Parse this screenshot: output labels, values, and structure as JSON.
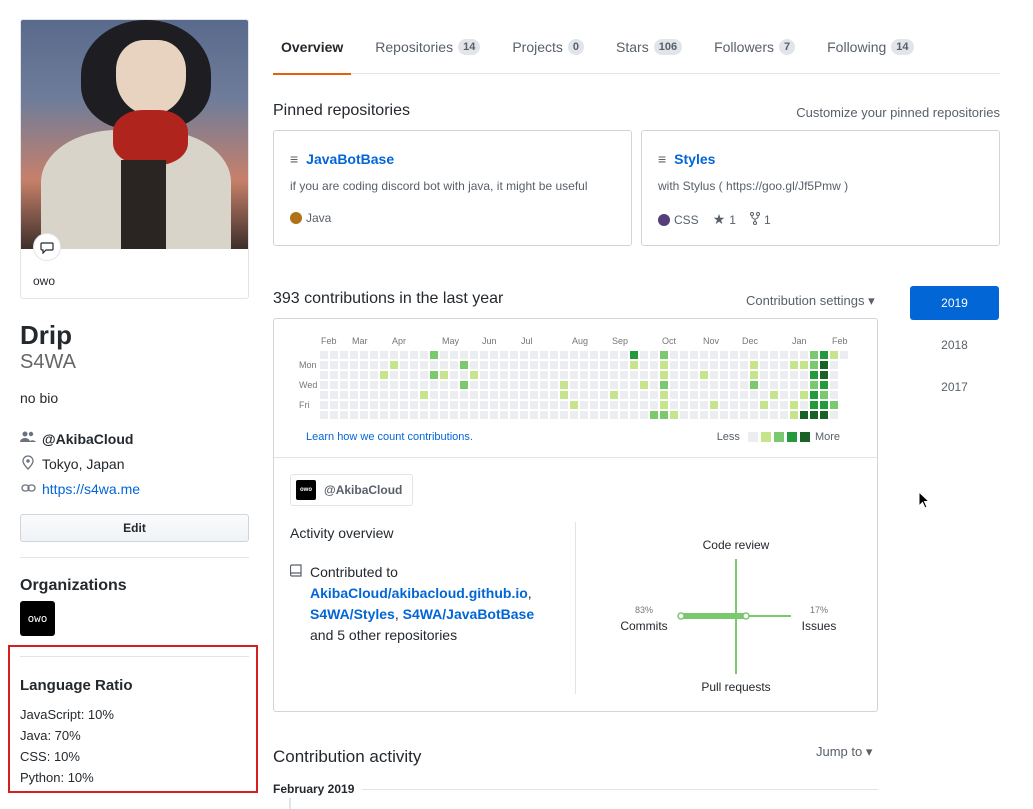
{
  "profile": {
    "status": "owo",
    "fullname": "Drip",
    "username": "S4WA",
    "bio": "no bio",
    "org": "@AkibaCloud",
    "location": "Tokyo, Japan",
    "website": "https://s4wa.me",
    "edit_label": "Edit"
  },
  "organizations": {
    "title": "Organizations",
    "logo_text": "owo"
  },
  "language_ratio": {
    "title": "Language Ratio",
    "items": [
      "JavaScript: 10%",
      "Java: 70%",
      "CSS: 10%",
      "Python: 10%"
    ]
  },
  "tabs": [
    {
      "label": "Overview",
      "count": ""
    },
    {
      "label": "Repositories",
      "count": "14"
    },
    {
      "label": "Projects",
      "count": "0"
    },
    {
      "label": "Stars",
      "count": "106"
    },
    {
      "label": "Followers",
      "count": "7"
    },
    {
      "label": "Following",
      "count": "14"
    }
  ],
  "pinned": {
    "title": "Pinned repositories",
    "customize": "Customize your pinned repositories",
    "repos": [
      {
        "name": "JavaBotBase",
        "desc": "if you are coding discord bot with java, it might be useful",
        "lang": "Java",
        "lang_color": "#b07219",
        "stars": "",
        "forks": ""
      },
      {
        "name": "Styles",
        "desc": "with Stylus ( https://goo.gl/Jf5Pmw )",
        "lang": "CSS",
        "lang_color": "#563d7c",
        "stars": "1",
        "forks": "1"
      }
    ]
  },
  "contributions": {
    "title": "393 contributions in the last year",
    "settings": "Contribution settings ▾",
    "months": [
      "Feb",
      "Mar",
      "Apr",
      "May",
      "Jun",
      "Jul",
      "Aug",
      "Sep",
      "Oct",
      "Nov",
      "Dec",
      "Jan",
      "Feb"
    ],
    "days": [
      "Mon",
      "Wed",
      "Fri"
    ],
    "learn": "Learn how we count contributions.",
    "less": "Less",
    "more": "More",
    "colors": [
      "#ebedf0",
      "#c6e48b",
      "#7bc96f",
      "#239a3b",
      "#196127"
    ]
  },
  "activity": {
    "user": "@AkibaCloud",
    "overview_title": "Activity overview",
    "contributed_to": "Contributed to",
    "repos": [
      "AkibaCloud/akibacloud.github.io",
      "S4WA/Styles",
      "S4WA/JavaBotBase"
    ],
    "others": "and 5 other repositories",
    "axes": {
      "code_review": "Code review",
      "commits": "Commits",
      "issues": "Issues",
      "pull_requests": "Pull requests",
      "commits_pct": "83%",
      "issues_pct": "17%"
    }
  },
  "years": [
    "2019",
    "2018",
    "2017"
  ],
  "contribution_activity": {
    "title": "Contribution activity",
    "jump": "Jump to ▾",
    "month": "February 2019"
  }
}
